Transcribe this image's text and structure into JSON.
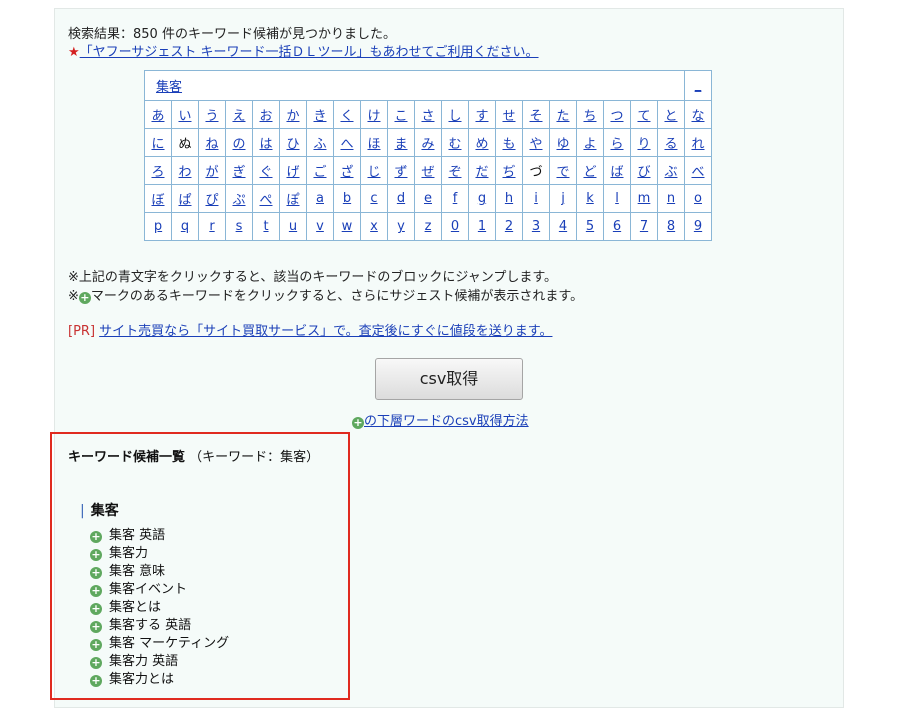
{
  "header": {
    "result_text": "検索結果：850 件のキーワード候補が見つかりました。",
    "promo_star": "★",
    "promo_link": "「ヤフーサジェスト キーワード一括ＤＬツール」もあわせてご利用ください。"
  },
  "kana_table": {
    "keyword": "集客",
    "corner_link": "_",
    "rows": [
      [
        "あ",
        "い",
        "う",
        "え",
        "お",
        "か",
        "き",
        "く",
        "け",
        "こ",
        "さ",
        "し",
        "す",
        "せ",
        "そ",
        "た",
        "ち",
        "つ",
        "て",
        "と",
        "な"
      ],
      [
        "に",
        "ぬ",
        "ね",
        "の",
        "は",
        "ひ",
        "ふ",
        "へ",
        "ほ",
        "ま",
        "み",
        "む",
        "め",
        "も",
        "や",
        "ゆ",
        "よ",
        "ら",
        "り",
        "る",
        "れ"
      ],
      [
        "ろ",
        "わ",
        "が",
        "ぎ",
        "ぐ",
        "げ",
        "ご",
        "ざ",
        "じ",
        "ず",
        "ぜ",
        "ぞ",
        "だ",
        "ぢ",
        "づ",
        "で",
        "ど",
        "ば",
        "び",
        "ぶ",
        "べ"
      ],
      [
        "ぼ",
        "ぱ",
        "ぴ",
        "ぷ",
        "ぺ",
        "ぽ",
        "a",
        "b",
        "c",
        "d",
        "e",
        "f",
        "g",
        "h",
        "i",
        "j",
        "k",
        "l",
        "m",
        "n",
        "o"
      ],
      [
        "p",
        "q",
        "r",
        "s",
        "t",
        "u",
        "v",
        "w",
        "x",
        "y",
        "z",
        "0",
        "1",
        "2",
        "3",
        "4",
        "5",
        "6",
        "7",
        "8",
        "9"
      ]
    ],
    "non_link_cells": [
      "ぬ",
      "づ"
    ]
  },
  "notes": {
    "line1": "※上記の青文字をクリックすると、該当のキーワードのブロックにジャンプします。",
    "line2_prefix": "※",
    "line2_suffix": "マークのあるキーワードをクリックすると、さらにサジェスト候補が表示されます。"
  },
  "pr": {
    "tag": "[PR]",
    "link": "サイト売買なら「サイト買取サービス」で。査定後にすぐに値段を送ります。"
  },
  "csv": {
    "button_label": "csv取得",
    "help_link": "の下層ワードのcsv取得方法"
  },
  "keywords": {
    "title_bold": "キーワード候補一覧",
    "title_rest": "（キーワード：集客）",
    "group_marker": "|",
    "group_heading": "集客",
    "items": [
      "集客 英語",
      "集客力",
      "集客 意味",
      "集客イベント",
      "集客とは",
      "集客する 英語",
      "集客 マーケティング",
      "集客力 英語",
      "集客力とは"
    ]
  },
  "icons": {
    "expand": "plus-circle-icon"
  },
  "colors": {
    "link": "#1a3fb8",
    "highlight_box": "#e02a1f",
    "pr_tag": "#c83232",
    "plus_icon": "#5fa85f",
    "star": "#d42020"
  }
}
